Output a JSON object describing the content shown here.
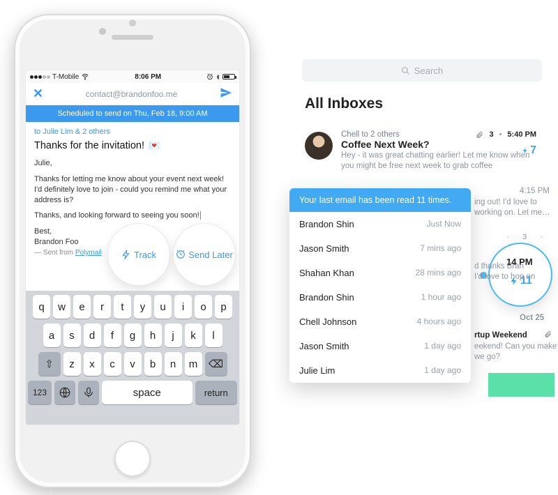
{
  "phone": {
    "status": {
      "carrier": "T-Mobile",
      "time": "8:06 PM"
    },
    "nav": {
      "from": "contact@brandonfoo.me"
    },
    "banner": "Scheduled to send on Thu, Feb 18, 9:00 AM",
    "compose": {
      "to": "to Julie Lim & 2 others",
      "subject": "Thanks for the invitation!",
      "greeting": "Julie,",
      "para1": "Thanks for letting me know about your event next week! I'd definitely love to join - could you remind me what your address is?",
      "para2": "Thanks, and looking forward to seeing you soon!",
      "signoff1": "Best,",
      "signoff2": "Brandon Foo",
      "sent_from_prefix": "— Sent from ",
      "sent_from_app": "Polymail"
    },
    "pills": {
      "track": "Track",
      "send_later": "Send Later"
    },
    "keyboard": {
      "row1": [
        "q",
        "w",
        "e",
        "r",
        "t",
        "y",
        "u",
        "i",
        "o",
        "p"
      ],
      "row2": [
        "a",
        "s",
        "d",
        "f",
        "g",
        "h",
        "j",
        "k",
        "l"
      ],
      "row3": [
        "z",
        "x",
        "c",
        "v",
        "b",
        "n",
        "m"
      ],
      "shift": "⇧",
      "backspace": "⌫",
      "num": "123",
      "space": "space",
      "ret": "return"
    }
  },
  "right": {
    "search_placeholder": "Search",
    "heading": "All Inboxes",
    "item1": {
      "from": "Chell to 2 others",
      "subject": "Coffee Next Week?",
      "snippet": "Hey - it was great chatting earlier! Let me know when you might be free next week to grab coffee",
      "count": "3",
      "time": "5:40 PM",
      "bolts": "7"
    },
    "time2": "4:15 PM",
    "partial1": "ing out! I'd love to",
    "partial2": "working on. Let me…",
    "highlight": {
      "dots": "3",
      "time": "14 PM",
      "bolts": "11",
      "thanks1": "d thanks Bran",
      "thanks2": "I'd love to hop on"
    },
    "oct": "Oct 25",
    "wk_subject": "rtup Weekend",
    "wk_line1": "eekend! Can you make",
    "wk_line2": "we go?"
  },
  "popover": {
    "head": "Your last email has been read 11 times.",
    "rows": [
      {
        "n": "Brandon Shin",
        "t": "Just Now"
      },
      {
        "n": "Jason Smith",
        "t": "7 mins ago"
      },
      {
        "n": "Shahan Khan",
        "t": "28 mins ago"
      },
      {
        "n": "Brandon Shin",
        "t": "1 hour ago"
      },
      {
        "n": "Chell Johnson",
        "t": "4 hours ago"
      },
      {
        "n": "Jason Smith",
        "t": "1 day ago"
      },
      {
        "n": "Julie Lim",
        "t": "1 day ago"
      }
    ]
  }
}
